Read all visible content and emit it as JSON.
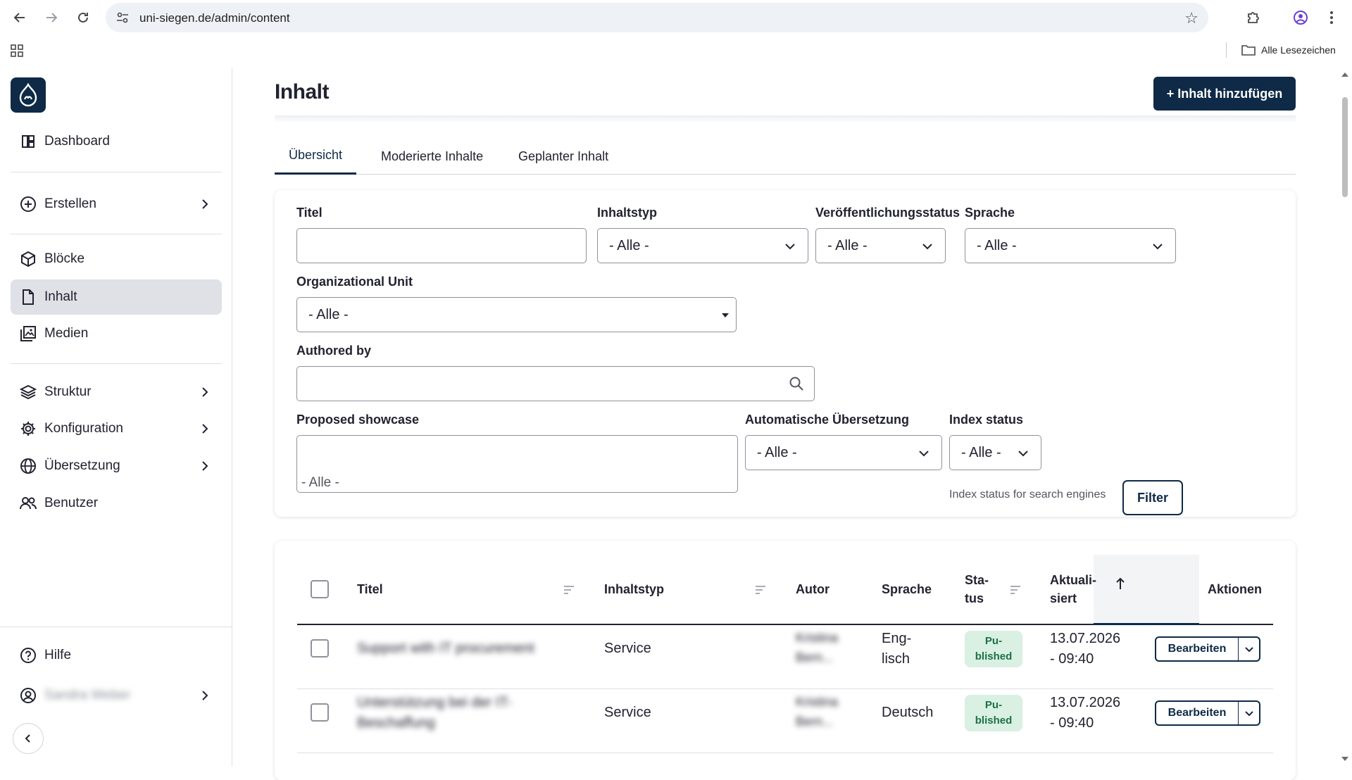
{
  "browser": {
    "url": "uni-siegen.de/admin/content",
    "bookmarks_label": "Alle Lesezeichen"
  },
  "sidebar": {
    "items": [
      {
        "label": "Dashboard",
        "icon": "dashboard-icon"
      },
      {
        "label": "Erstellen",
        "icon": "plus-circle-icon"
      },
      {
        "label": "Blöcke",
        "icon": "cube-icon"
      },
      {
        "label": "Inhalt",
        "icon": "document-icon",
        "active": true
      },
      {
        "label": "Medien",
        "icon": "image-icon"
      },
      {
        "label": "Struktur",
        "icon": "layers-icon"
      },
      {
        "label": "Konfiguration",
        "icon": "gear-icon"
      },
      {
        "label": "Übersetzung",
        "icon": "globe-icon"
      },
      {
        "label": "Benutzer",
        "icon": "users-icon"
      }
    ],
    "help_label": "Hilfe",
    "user_name": "Sandra Weber"
  },
  "header": {
    "title": "Inhalt",
    "add_button": "+ Inhalt hinzufügen"
  },
  "tabs": [
    "Übersicht",
    "Moderierte Inhalte",
    "Geplanter Inhalt"
  ],
  "filters": {
    "title_label": "Titel",
    "type_label": "Inhaltstyp",
    "type_value": "- Alle -",
    "status_label": "Veröffentlichungsstatus",
    "status_value": "- Alle -",
    "language_label": "Sprache",
    "language_value": "- Alle -",
    "org_label": "Organizational Unit",
    "org_value": "- Alle -",
    "authored_label": "Authored by",
    "showcase_label": "Proposed showcase",
    "showcase_value": "- Alle -",
    "auto_label": "Automatische Übersetzung",
    "auto_value": "- Alle -",
    "index_label": "Index status",
    "index_value": "- Alle -",
    "index_hint": "Index status for search engines",
    "filter_button": "Filter"
  },
  "table": {
    "headers": {
      "title": "Titel",
      "type": "Inhaltstyp",
      "author": "Autor",
      "language": "Sprache",
      "status_1": "Sta-",
      "status_2": "tus",
      "updated_1": "Aktuali-",
      "updated_2": "siert",
      "actions": "Aktionen"
    },
    "rows": [
      {
        "title": "Support with IT procurement",
        "type": "Service",
        "author_1": "Kristina",
        "author_2": "Bern...",
        "lang_1": "Eng-",
        "lang_2": "lisch",
        "status_1": "Pu-",
        "status_2": "blished",
        "date_1": "13.07.2026",
        "date_2": "- 09:40",
        "action": "Bearbeiten"
      },
      {
        "title_1": "Unterstützung bei der IT-",
        "title_2": "Beschaffung",
        "type": "Service",
        "author_1": "Kristina",
        "author_2": "Bern...",
        "lang_1": "Deutsch",
        "lang_2": "",
        "status_1": "Pu-",
        "status_2": "blished",
        "date_1": "13.07.2026",
        "date_2": "- 09:40",
        "action": "Bearbeiten"
      }
    ]
  },
  "colors": {
    "primary": "#0e2a47",
    "active_bg": "#dfe1e7",
    "badge_bg": "#d9f0e3",
    "badge_text": "#1e7145"
  }
}
